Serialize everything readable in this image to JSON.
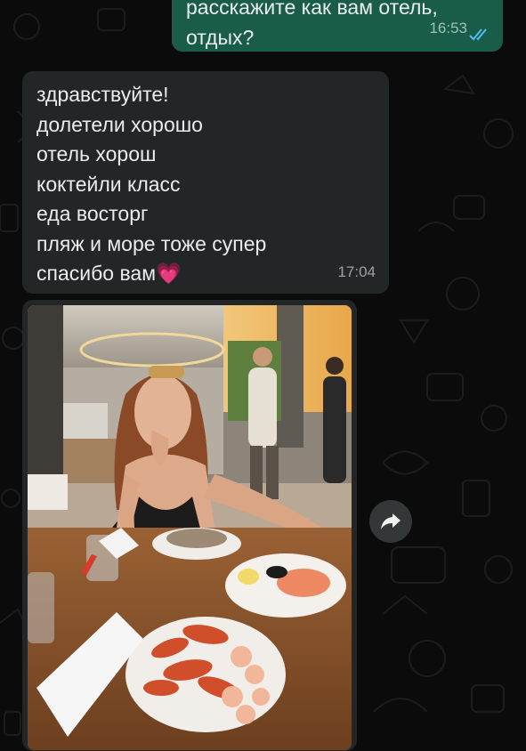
{
  "chat": {
    "outgoing": {
      "lines": [
        "расскажите как вам отель,",
        "отдых?"
      ],
      "time": "16:53",
      "status_icon": "double-check-read-icon"
    },
    "incoming": {
      "lines": [
        "здравствуйте!",
        "долетели хорошо",
        "отель хорош",
        "коктейли класс",
        "еда восторг",
        "пляж и море тоже супер",
        "спасибо вам"
      ],
      "emoji": "💗",
      "time": "17:04"
    },
    "photo_message": {
      "forward_icon": "forward-arrow-icon"
    }
  },
  "colors": {
    "background": "#0b0b0b",
    "outgoing_bubble": "#1a5c4a",
    "incoming_bubble": "#232626",
    "read_ticks": "#53bdeb"
  }
}
